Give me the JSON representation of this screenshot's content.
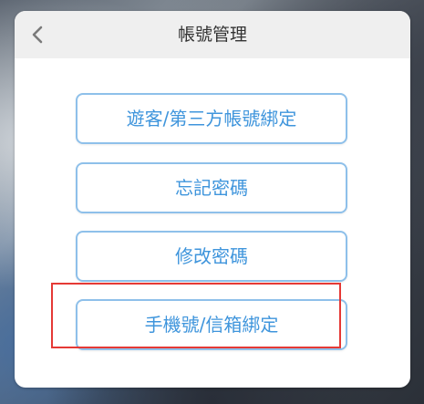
{
  "header": {
    "title": "帳號管理",
    "back_icon": "chevron-left-icon"
  },
  "menu": {
    "items": [
      {
        "label": "遊客/第三方帳號綁定"
      },
      {
        "label": "忘記密碼"
      },
      {
        "label": "修改密碼"
      },
      {
        "label": "手機號/信箱綁定",
        "highlighted": true
      }
    ]
  },
  "colors": {
    "accent": "#3f95dc",
    "button_border": "#8ec0ea",
    "highlight": "#e53935",
    "header_bg": "#efefef"
  }
}
